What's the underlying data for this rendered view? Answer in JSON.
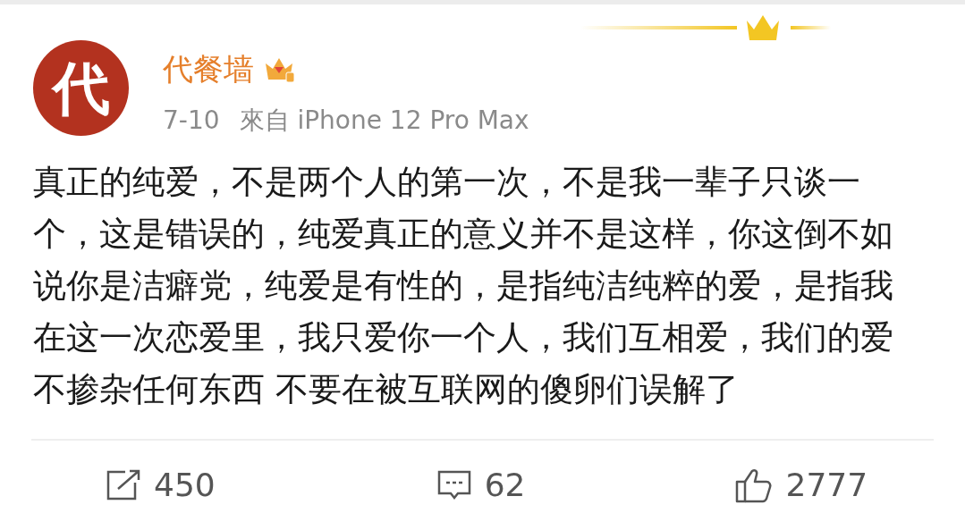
{
  "post": {
    "avatar_text": "代",
    "author": "代餐墙",
    "date": "7-10",
    "source": "來自 iPhone 12 Pro Max",
    "body": "真正的纯爱，不是两个人的第一次，不是我一辈子只谈一个，这是错误的，纯爱真正的意义并不是这样，你这倒不如说你是洁癖党，纯爱是有性的，是指纯洁纯粹的爱，是指我在这一次恋爱里，我只爱你一个人，我们互相爱，我们的爱不掺杂任何东西 不要在被互联网的傻卵们误解了"
  },
  "actions": [
    {
      "kind": "repost",
      "count": "450"
    },
    {
      "kind": "comment",
      "count": "62"
    },
    {
      "kind": "like",
      "count": "2777"
    }
  ]
}
